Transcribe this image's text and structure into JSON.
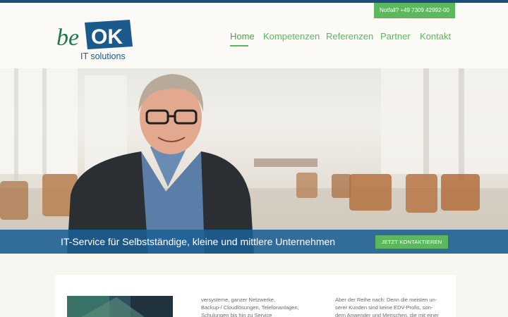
{
  "header": {
    "logo": {
      "text_be": "be",
      "text_ok": "OK",
      "tagline": "IT solutions"
    },
    "emergency": "Notfall? +49 7309 42992-00",
    "nav": [
      {
        "label": "Home",
        "active": true
      },
      {
        "label": "Kompetenzen",
        "active": false
      },
      {
        "label": "Referenzen",
        "active": false
      },
      {
        "label": "Partner",
        "active": false
      },
      {
        "label": "Kontakt",
        "active": false
      }
    ]
  },
  "hero": {
    "banner_text": "IT-Service für Selbstständige, kleine und mittlere Unternehmen",
    "cta_label": "JETZT KONTAKTIEREN"
  },
  "content": {
    "col2_lines": [
      "versysteme, ganzer Netzwerke,",
      "Backup-/ Cloudlösungen, Telefonanlagen,",
      "Schulungen bis hin zu Service"
    ],
    "col3_lines": [
      "Aber der Reihe nach: Denn die meisten un-",
      "serer Kunden sind keine EDV-Profis, son-",
      "dern Anwender und Menschen, die mit einer"
    ]
  },
  "colors": {
    "brand_blue": "#1b4f7a",
    "brand_green": "#5cb85c",
    "banner_blue": "#1b6094"
  }
}
